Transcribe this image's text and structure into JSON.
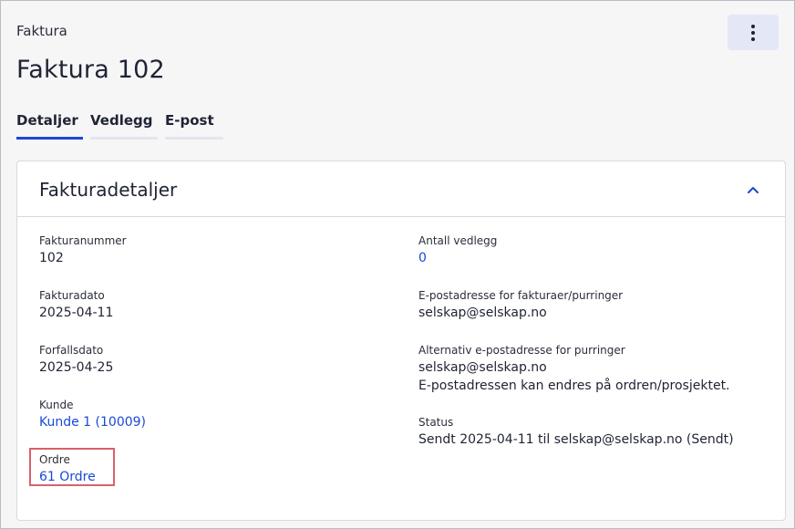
{
  "breadcrumb": "Faktura",
  "page_title": "Faktura 102",
  "tabs": [
    {
      "label": "Detaljer",
      "active": true
    },
    {
      "label": "Vedlegg",
      "active": false
    },
    {
      "label": "E-post",
      "active": false
    }
  ],
  "panel": {
    "title": "Fakturadetaljer",
    "left_fields": [
      {
        "label": "Fakturanummer",
        "value": "102"
      },
      {
        "label": "Fakturadato",
        "value": "2025-04-11"
      },
      {
        "label": "Forfallsdato",
        "value": "2025-04-25"
      },
      {
        "label": "Kunde",
        "value": "Kunde 1 (10009)"
      },
      {
        "label": "Ordre",
        "value": "61 Ordre"
      }
    ],
    "right_fields": [
      {
        "label": "Antall vedlegg",
        "value": "0"
      },
      {
        "label": "E-postadresse for fakturaer/purringer",
        "value": "selskap@selskap.no"
      },
      {
        "label": "Alternativ e-postadresse for purringer",
        "value": "selskap@selskap.no",
        "note": "E-postadressen kan endres på ordren/prosjektet."
      },
      {
        "label": "Status",
        "value": "Sendt 2025-04-11 til selskap@selskap.no (Sendt)"
      }
    ]
  },
  "colors": {
    "accent": "#1a49d6",
    "highlight": "#d9616b"
  },
  "icons": {
    "menu": "more-vertical-icon",
    "collapse": "chevron-up-icon"
  }
}
